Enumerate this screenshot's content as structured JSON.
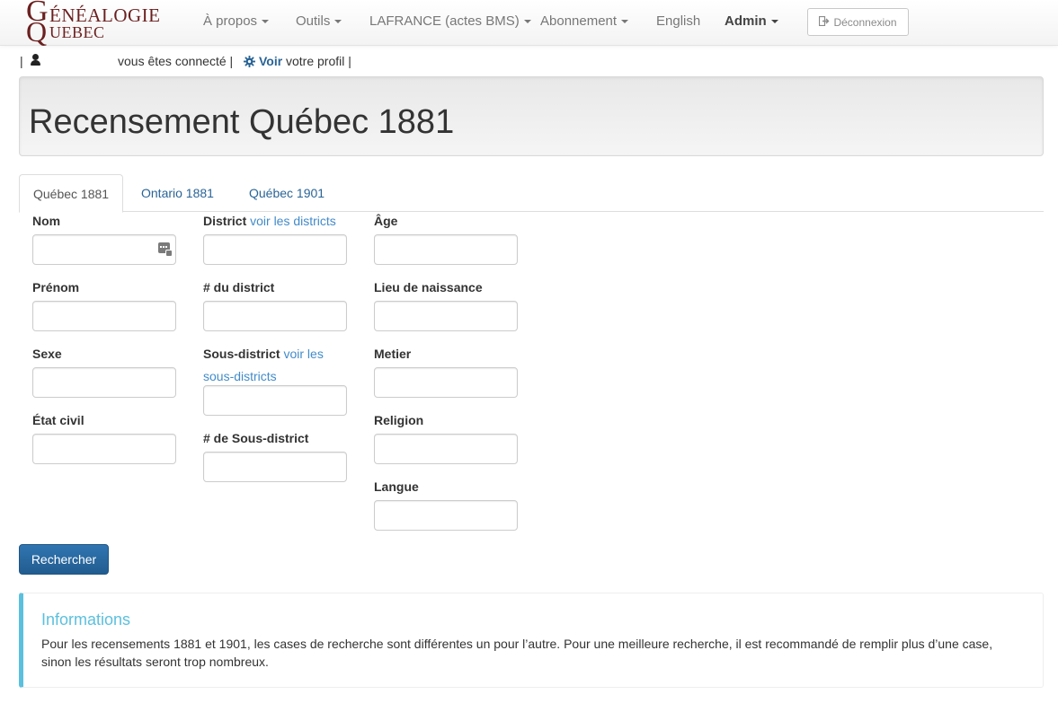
{
  "brand": {
    "line1_initial": "G",
    "line1_rest": "ÉNÉALOGIE",
    "line2_initial": "Q",
    "line2_rest": "UEBEC",
    "color": "#6b1f1f"
  },
  "nav": {
    "items": [
      {
        "label": "À propos",
        "dropdown": true
      },
      {
        "label": "Outils",
        "dropdown": true
      },
      {
        "label": "LAFRANCE (actes BMS)",
        "dropdown": true
      },
      {
        "label": "Abonnement",
        "dropdown": true
      },
      {
        "label": "English",
        "dropdown": false
      },
      {
        "label": "Admin",
        "dropdown": true
      }
    ],
    "logout_label": "Déconnexion",
    "logout_icon": "sign-out-icon"
  },
  "userline": {
    "separator": "|",
    "user_icon": "user-icon",
    "connected_text": "vous êtes connecté |",
    "gear_icon": "gear-icon",
    "view_link": "Voir",
    "profile_text": "votre profil |"
  },
  "page_title": "Recensement Québec 1881",
  "tabs": [
    {
      "label": "Québec 1881",
      "active": true
    },
    {
      "label": "Ontario 1881",
      "active": false
    },
    {
      "label": "Québec 1901",
      "active": false
    }
  ],
  "form": {
    "col1": {
      "nom": "Nom",
      "prenom": "Prénom",
      "sexe": "Sexe",
      "etat_civil": "État civil"
    },
    "col2": {
      "district": "District",
      "district_link": "voir les districts",
      "no_district": "# du district",
      "sous_district": "Sous-district",
      "sous_district_link_1": "voir les",
      "sous_district_link_2": "sous-districts",
      "no_sous_district": "# de Sous-district"
    },
    "col3": {
      "age": "Âge",
      "lieu_naissance": "Lieu de naissance",
      "metier": "Metier",
      "religion": "Religion",
      "langue": "Langue"
    },
    "submit": "Rechercher"
  },
  "info": {
    "title": "Informations",
    "text": "Pour les recensements 1881 et 1901, les cases de recherche sont différentes un pour l’autre. Pour une meilleure recherche, il est recommandé de remplir plus d’une case, sinon les résultats seront trop nombreux.",
    "accent": "#5bc0de"
  },
  "colors": {
    "link": "#428bca",
    "primary_button": "#2a6ba3"
  }
}
